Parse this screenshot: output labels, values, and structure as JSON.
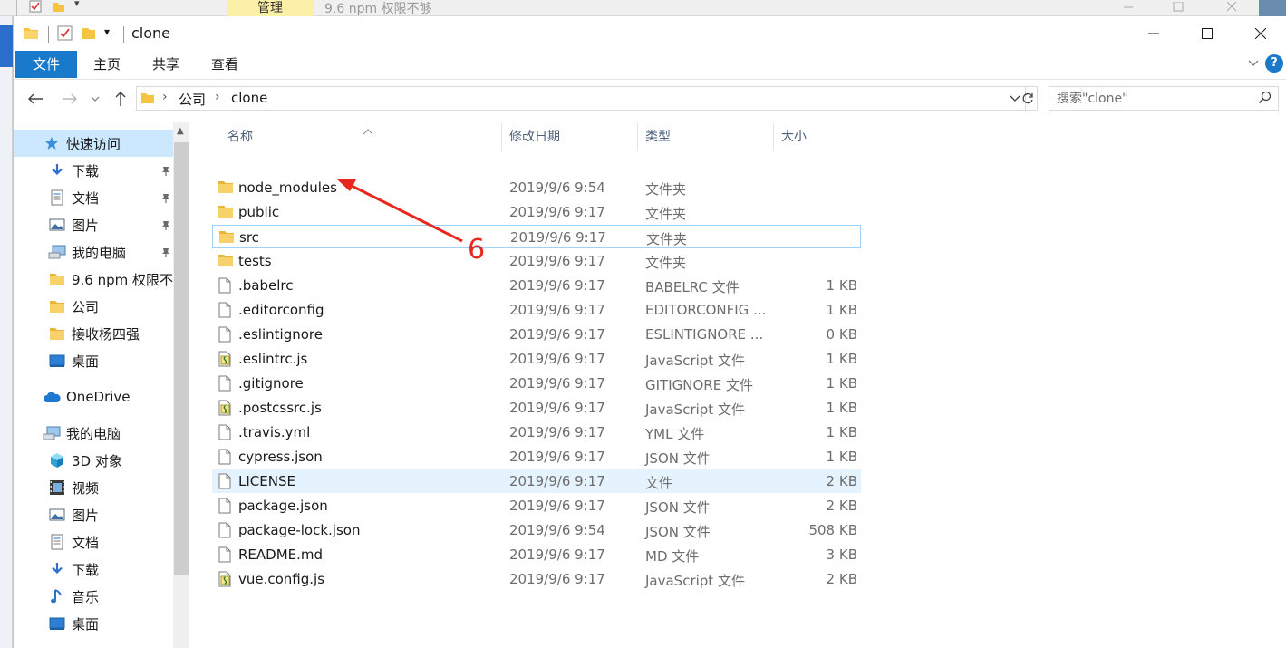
{
  "background_window": {
    "tab": "管理",
    "title": "9.6 npm 权限不够"
  },
  "window": {
    "title": "clone"
  },
  "ribbon": {
    "tabs": [
      "文件",
      "主页",
      "共享",
      "查看"
    ]
  },
  "address": {
    "crumbs": [
      "公司",
      "clone"
    ]
  },
  "search": {
    "placeholder": "搜索\"clone\""
  },
  "sidebar": {
    "items": [
      {
        "label": "快速访问",
        "icon": "star-icon",
        "selected": true,
        "indent": 1,
        "pinned": false
      },
      {
        "label": "下载",
        "icon": "download-icon",
        "indent": 2,
        "pinned": true
      },
      {
        "label": "文档",
        "icon": "document-icon",
        "indent": 2,
        "pinned": true
      },
      {
        "label": "图片",
        "icon": "picture-icon",
        "indent": 2,
        "pinned": true
      },
      {
        "label": "我的电脑",
        "icon": "computer-icon",
        "indent": 2,
        "pinned": true
      },
      {
        "label": "9.6 npm 权限不",
        "icon": "folder-icon",
        "indent": 2,
        "pinned": false
      },
      {
        "label": "公司",
        "icon": "folder-icon",
        "indent": 2,
        "pinned": false
      },
      {
        "label": "接收杨四强",
        "icon": "folder-icon",
        "indent": 2,
        "pinned": false
      },
      {
        "label": "桌面",
        "icon": "desktop-icon",
        "indent": 2,
        "pinned": false
      },
      {
        "label": "OneDrive",
        "icon": "cloud-icon",
        "indent": 1,
        "pinned": false
      },
      {
        "label": "我的电脑",
        "icon": "computer-icon",
        "indent": 1,
        "pinned": false
      },
      {
        "label": "3D 对象",
        "icon": "cube-icon",
        "indent": 2,
        "pinned": false
      },
      {
        "label": "视频",
        "icon": "video-icon",
        "indent": 2,
        "pinned": false
      },
      {
        "label": "图片",
        "icon": "picture-icon",
        "indent": 2,
        "pinned": false
      },
      {
        "label": "文档",
        "icon": "document-icon",
        "indent": 2,
        "pinned": false
      },
      {
        "label": "下载",
        "icon": "download-icon",
        "indent": 2,
        "pinned": false
      },
      {
        "label": "音乐",
        "icon": "music-icon",
        "indent": 2,
        "pinned": false
      },
      {
        "label": "桌面",
        "icon": "desktop-icon",
        "indent": 2,
        "pinned": false
      }
    ]
  },
  "columns": {
    "name": "名称",
    "date": "修改日期",
    "type": "类型",
    "size": "大小"
  },
  "files": [
    {
      "name": "node_modules",
      "date": "2019/9/6 9:54",
      "type": "文件夹",
      "size": "",
      "icon": "folder-icon"
    },
    {
      "name": "public",
      "date": "2019/9/6 9:17",
      "type": "文件夹",
      "size": "",
      "icon": "folder-icon"
    },
    {
      "name": "src",
      "date": "2019/9/6 9:17",
      "type": "文件夹",
      "size": "",
      "icon": "folder-icon",
      "focus": true
    },
    {
      "name": "tests",
      "date": "2019/9/6 9:17",
      "type": "文件夹",
      "size": "",
      "icon": "folder-icon"
    },
    {
      "name": ".babelrc",
      "date": "2019/9/6 9:17",
      "type": "BABELRC 文件",
      "size": "1 KB",
      "icon": "file-icon"
    },
    {
      "name": ".editorconfig",
      "date": "2019/9/6 9:17",
      "type": "EDITORCONFIG ...",
      "size": "1 KB",
      "icon": "file-icon"
    },
    {
      "name": ".eslintignore",
      "date": "2019/9/6 9:17",
      "type": "ESLINTIGNORE ...",
      "size": "0 KB",
      "icon": "file-icon"
    },
    {
      "name": ".eslintrc.js",
      "date": "2019/9/6 9:17",
      "type": "JavaScript 文件",
      "size": "1 KB",
      "icon": "script-file-icon"
    },
    {
      "name": ".gitignore",
      "date": "2019/9/6 9:17",
      "type": "GITIGNORE 文件",
      "size": "1 KB",
      "icon": "file-icon"
    },
    {
      "name": ".postcssrc.js",
      "date": "2019/9/6 9:17",
      "type": "JavaScript 文件",
      "size": "1 KB",
      "icon": "script-file-icon"
    },
    {
      "name": ".travis.yml",
      "date": "2019/9/6 9:17",
      "type": "YML 文件",
      "size": "1 KB",
      "icon": "file-icon"
    },
    {
      "name": "cypress.json",
      "date": "2019/9/6 9:17",
      "type": "JSON 文件",
      "size": "1 KB",
      "icon": "file-icon"
    },
    {
      "name": "LICENSE",
      "date": "2019/9/6 9:17",
      "type": "文件",
      "size": "2 KB",
      "icon": "file-icon",
      "hover": true
    },
    {
      "name": "package.json",
      "date": "2019/9/6 9:17",
      "type": "JSON 文件",
      "size": "2 KB",
      "icon": "file-icon"
    },
    {
      "name": "package-lock.json",
      "date": "2019/9/6 9:54",
      "type": "JSON 文件",
      "size": "508 KB",
      "icon": "file-icon"
    },
    {
      "name": "README.md",
      "date": "2019/9/6 9:17",
      "type": "MD 文件",
      "size": "3 KB",
      "icon": "file-icon"
    },
    {
      "name": "vue.config.js",
      "date": "2019/9/6 9:17",
      "type": "JavaScript 文件",
      "size": "2 KB",
      "icon": "script-file-icon"
    }
  ],
  "annotation": {
    "label": "6",
    "color": "#e8281f"
  },
  "colors": {
    "accent": "#1979ca",
    "selected": "#cce8ff",
    "hover": "#e5f3ff",
    "folder": "#f5c542"
  }
}
